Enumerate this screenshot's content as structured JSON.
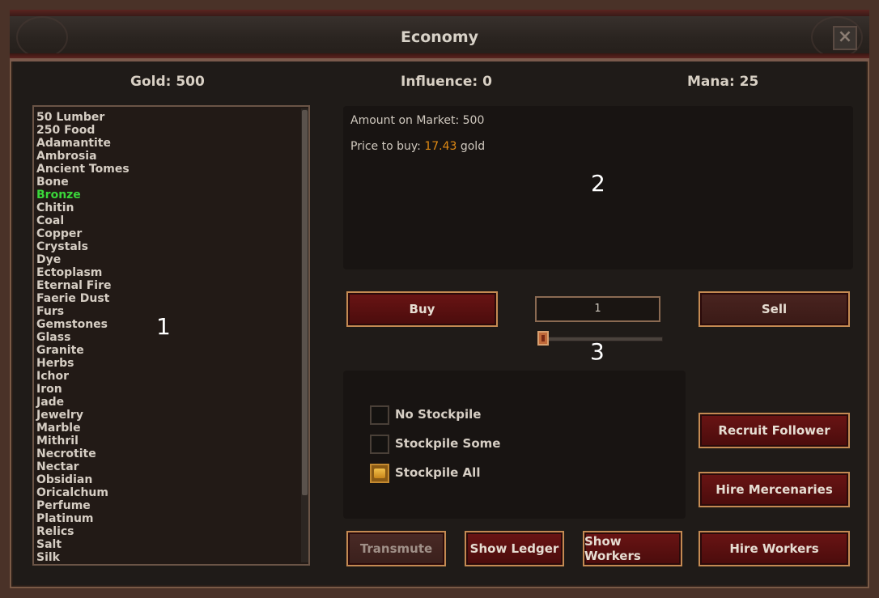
{
  "window": {
    "title": "Economy"
  },
  "resources": {
    "gold": "Gold: 500",
    "influence": "Influence: 0",
    "mana": "Mana: 25"
  },
  "resource_list": {
    "selected": "Bronze",
    "items": [
      "50 Lumber",
      "250 Food",
      "Adamantite",
      "Ambrosia",
      "Ancient Tomes",
      "Bone",
      "Bronze",
      "Chitin",
      "Coal",
      "Copper",
      "Crystals",
      "Dye",
      "Ectoplasm",
      "Eternal Fire",
      "Faerie Dust",
      "Furs",
      "Gemstones",
      "Glass",
      "Granite",
      "Herbs",
      "Ichor",
      "Iron",
      "Jade",
      "Jewelry",
      "Marble",
      "Mithril",
      "Necrotite",
      "Nectar",
      "Obsidian",
      "Oricalchum",
      "Perfume",
      "Platinum",
      "Relics",
      "Salt",
      "Silk"
    ]
  },
  "markers": {
    "m1": "1",
    "m2": "2",
    "m3": "3"
  },
  "market_info": {
    "amount": "Amount on Market: 500",
    "price_prefix": "Price to buy: ",
    "price_value": "17.43",
    "price_suffix": " gold"
  },
  "trade": {
    "buy": "Buy",
    "sell": "Sell",
    "quantity": "1"
  },
  "stockpile": {
    "none": "No Stockpile",
    "some": "Stockpile Some",
    "all": "Stockpile All",
    "checked": "all"
  },
  "actions": {
    "recruit": "Recruit Follower",
    "mercenaries": "Hire Mercenaries",
    "transmute": "Transmute",
    "ledger": "Show Ledger",
    "show_workers": "Show Workers",
    "hire_workers": "Hire Workers"
  },
  "colors": {
    "selected_item": "#3ad63a",
    "price": "#e08a14",
    "button_border": "#c48a52"
  }
}
